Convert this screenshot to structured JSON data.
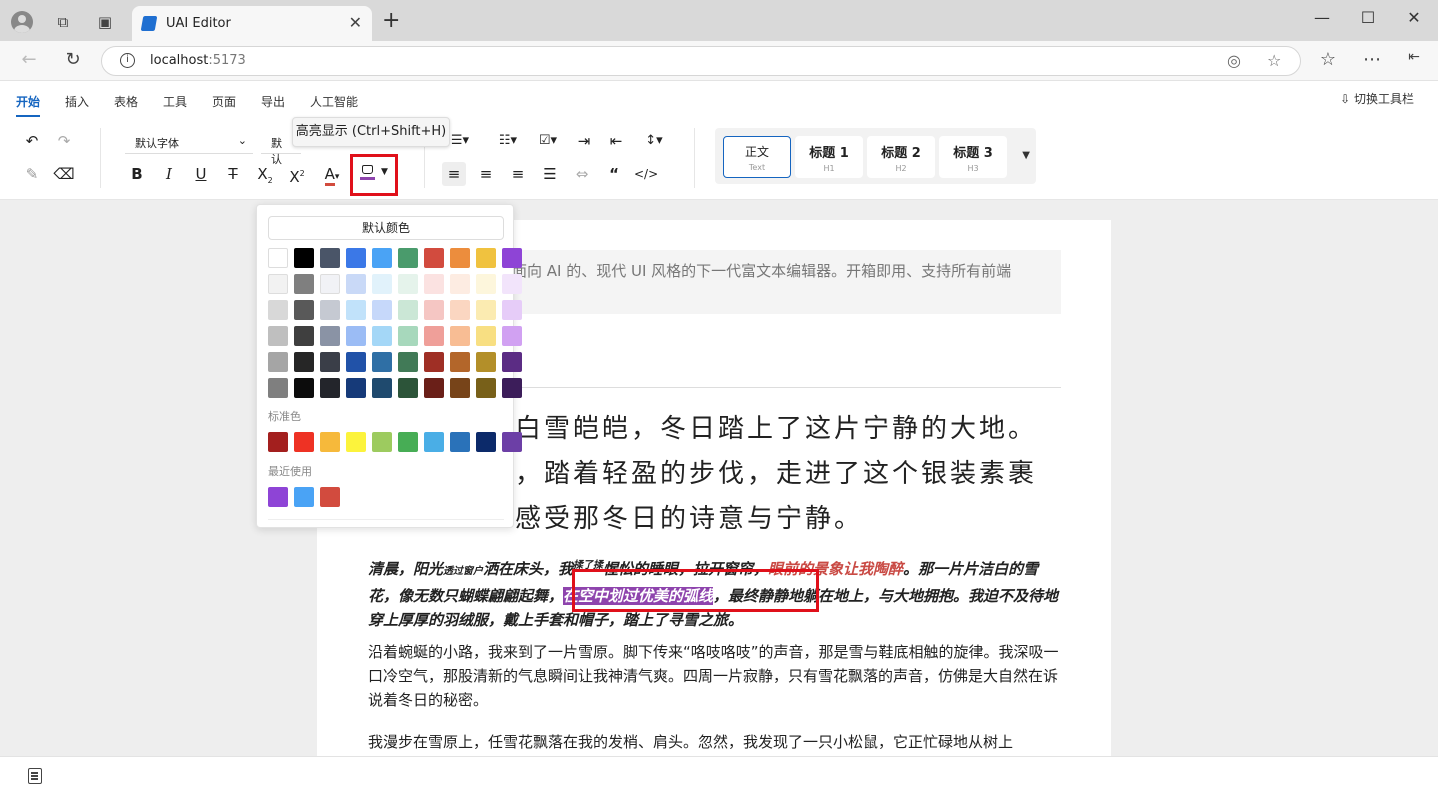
{
  "browser": {
    "tab_title": "UAI Editor",
    "url_host": "localhost",
    "url_port": ":5173"
  },
  "menu": {
    "tabs": [
      "开始",
      "插入",
      "表格",
      "工具",
      "页面",
      "导出",
      "人工智能"
    ],
    "toggle_toolbar": "切换工具栏"
  },
  "toolbar": {
    "font_family": "默认字体",
    "font_size": "默认",
    "highlight_tooltip": "高亮显示 (Ctrl+Shift+H)",
    "highlight_color": "#8e44ad",
    "styles": [
      {
        "label": "正文",
        "sub": "Text"
      },
      {
        "label": "标题 1",
        "sub": "H1"
      },
      {
        "label": "标题 2",
        "sub": "H2"
      },
      {
        "label": "标题 3",
        "sub": "H3"
      }
    ]
  },
  "color_picker": {
    "default_label": "默认颜色",
    "palette": [
      [
        "#ffffff",
        "#000000",
        "#4a5568",
        "#3b78e7",
        "#4aa3f5",
        "#4a9b6c",
        "#d24b3e",
        "#ec8d3d",
        "#f0c23f",
        "#8e44d6"
      ],
      [
        "#f2f2f2",
        "#7f7f7f",
        "#f1f2f6",
        "#c9d9f7",
        "#e1f2fb",
        "#e5f3eb",
        "#fbe2e1",
        "#fdece2",
        "#fdf6dc",
        "#f2e4fb"
      ],
      [
        "#d8d8d8",
        "#595959",
        "#c5c9d2",
        "#c1e2fa",
        "#c6d8fa",
        "#cbe7d6",
        "#f5c6c3",
        "#fbd6c1",
        "#fbebb1",
        "#e6ccf8"
      ],
      [
        "#bfbfbf",
        "#3f3f3f",
        "#8a93a5",
        "#9bbcf5",
        "#a4d7f7",
        "#a7d8bc",
        "#ef9f99",
        "#f8bd94",
        "#f8df82",
        "#d1a1f2"
      ],
      [
        "#a5a5a5",
        "#262626",
        "#3a3e48",
        "#2152a8",
        "#2f6fa5",
        "#417a57",
        "#9f2f25",
        "#b3662a",
        "#b38f29",
        "#5b2c84"
      ],
      [
        "#7f7f7f",
        "#0c0c0c",
        "#23252b",
        "#163a79",
        "#1f4a6e",
        "#2c5439",
        "#6a1f18",
        "#774419",
        "#786019",
        "#3c1d5a"
      ]
    ],
    "standard_label": "标准色",
    "standard": [
      "#a31f1e",
      "#ee3224",
      "#f6b93b",
      "#fcf33c",
      "#9dcb5f",
      "#47ad55",
      "#4aaee6",
      "#2a72b9",
      "#0c2a6a",
      "#6c3fa6"
    ],
    "recent_label": "最近使用",
    "recent": [
      "#8e44d6",
      "#4aa3f5",
      "#d24b3e"
    ]
  },
  "document": {
    "quote": "面向 AI 的、现代 UI 风格的下一代富文本编辑器。开箱即用、支持所有前端",
    "poem": [
      "白雪皑皑，冬日踏上了这片宁静的大地。",
      "，踏着轻盈的步伐，走进了这个银装素裹",
      "感受那冬日的诗意与宁静。"
    ],
    "bold_para": {
      "a": "清晨，阳光",
      "b_small": "透过窗户",
      "c": "洒在床头，我",
      "d_sup": "揉了揉",
      "e": "惺忪的睡眼，拉开窗帘，",
      "f_red": "眼前的景象让我陶醉",
      "g": "。那一片片洁白的雪花，像无数只蝴蝶翩翩起舞，",
      "h_highlight": "在空中划过优美的弧线",
      "i": "，最终静静地躺在地上，与大地拥抱。我迫不及待地穿上厚厚的羽绒服，戴上手套和帽子，踏上了寻雪之旅。"
    },
    "para2": "沿着蜿蜒的小路，我来到了一片雪原。脚下传来“咯吱咯吱”的声音，那是雪与鞋底相触的旋律。我深吸一口冷空气，那股清新的气息瞬间让我神清气爽。四周一片寂静，只有雪花飘落的声音，仿佛是大自然在诉说着冬日的秘密。",
    "para3": "我漫步在雪原上，任雪花飘落在我的发梢、肩头。忽然，我发现了一只小松鼠，它正忙碌地从树上"
  }
}
